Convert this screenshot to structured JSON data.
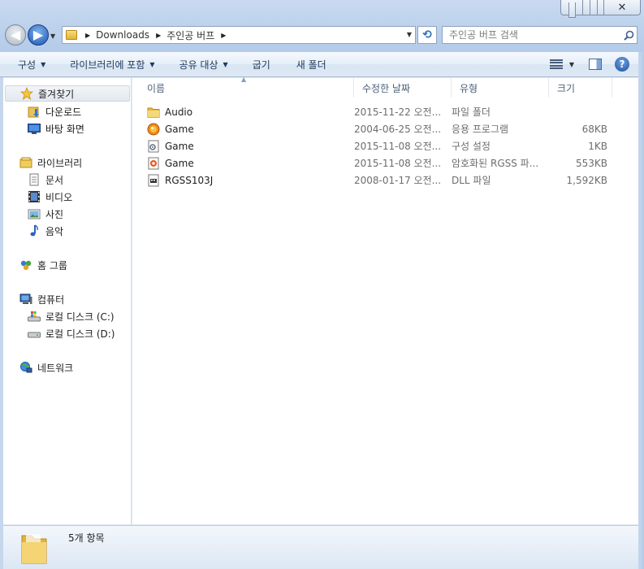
{
  "address": {
    "crumbs": [
      "Downloads",
      "주인공 버프"
    ]
  },
  "search": {
    "placeholder": "주인공 버프 검색"
  },
  "toolbar": {
    "organize": "구성",
    "include_library": "라이브러리에 포함",
    "share_with": "공유 대상",
    "burn": "굽기",
    "new_folder": "새 폴더"
  },
  "nav": {
    "favorites": {
      "label": "즐겨찾기",
      "items": [
        "다운로드",
        "바탕 화면"
      ]
    },
    "libraries": {
      "label": "라이브러리",
      "items": [
        "문서",
        "비디오",
        "사진",
        "음악"
      ]
    },
    "homegroup": {
      "label": "홈 그룹"
    },
    "computer": {
      "label": "컴퓨터",
      "items": [
        "로컬 디스크 (C:)",
        "로컬 디스크 (D:)"
      ]
    },
    "network": {
      "label": "네트워크"
    }
  },
  "columns": {
    "name": "이름",
    "date": "수정한 날짜",
    "type": "유형",
    "size": "크기"
  },
  "files": [
    {
      "name": "Audio",
      "date": "2015-11-22 오전...",
      "type": "파일 폴더",
      "size": "",
      "icon": "folder-icon"
    },
    {
      "name": "Game",
      "date": "2004-06-25 오전...",
      "type": "응용 프로그램",
      "size": "68KB",
      "icon": "game-exe-icon"
    },
    {
      "name": "Game",
      "date": "2015-11-08 오전...",
      "type": "구성 설정",
      "size": "1KB",
      "icon": "config-file-icon"
    },
    {
      "name": "Game",
      "date": "2015-11-08 오전...",
      "type": "암호화된 RGSS 파...",
      "size": "553KB",
      "icon": "rgss-archive-icon"
    },
    {
      "name": "RGSS103J",
      "date": "2008-01-17 오전...",
      "type": "DLL 파일",
      "size": "1,592KB",
      "icon": "dll-file-icon"
    }
  ],
  "status": {
    "item_count": "5개 항목"
  }
}
